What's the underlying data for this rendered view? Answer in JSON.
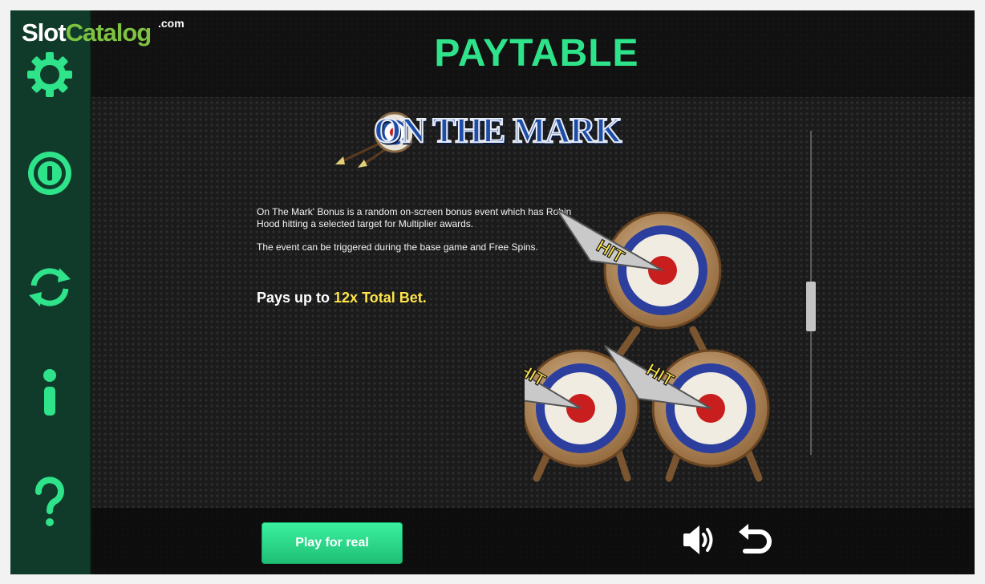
{
  "watermark": {
    "slot": "Slot",
    "catalog": "Catalog",
    "com": ".com"
  },
  "header": {
    "title": "PAYTABLE"
  },
  "game_logo": {
    "text": "ON THE MARK"
  },
  "content": {
    "paragraph1": "On The Mark' Bonus is a random on-screen bonus event which has Robin Hood hitting a selected target for Multiplier awards.",
    "paragraph2": "The event can be triggered during the base game and Free Spins.",
    "pays_prefix": "Pays up to ",
    "pays_highlight": "12x Total Bet."
  },
  "targets": {
    "hit_label": "HIT"
  },
  "scrollbar": {
    "position": 0.55
  },
  "footer": {
    "play_label": "Play for real"
  },
  "sidebar": {
    "items": [
      {
        "name": "settings",
        "icon": "gear-icon"
      },
      {
        "name": "bet",
        "icon": "coin-icon"
      },
      {
        "name": "autoplay",
        "icon": "refresh-icon"
      },
      {
        "name": "info",
        "icon": "info-icon"
      },
      {
        "name": "help",
        "icon": "question-icon"
      }
    ]
  },
  "colors": {
    "accent": "#2ee38a",
    "sidebar": "#103b2a",
    "highlight": "#ffe44a"
  }
}
